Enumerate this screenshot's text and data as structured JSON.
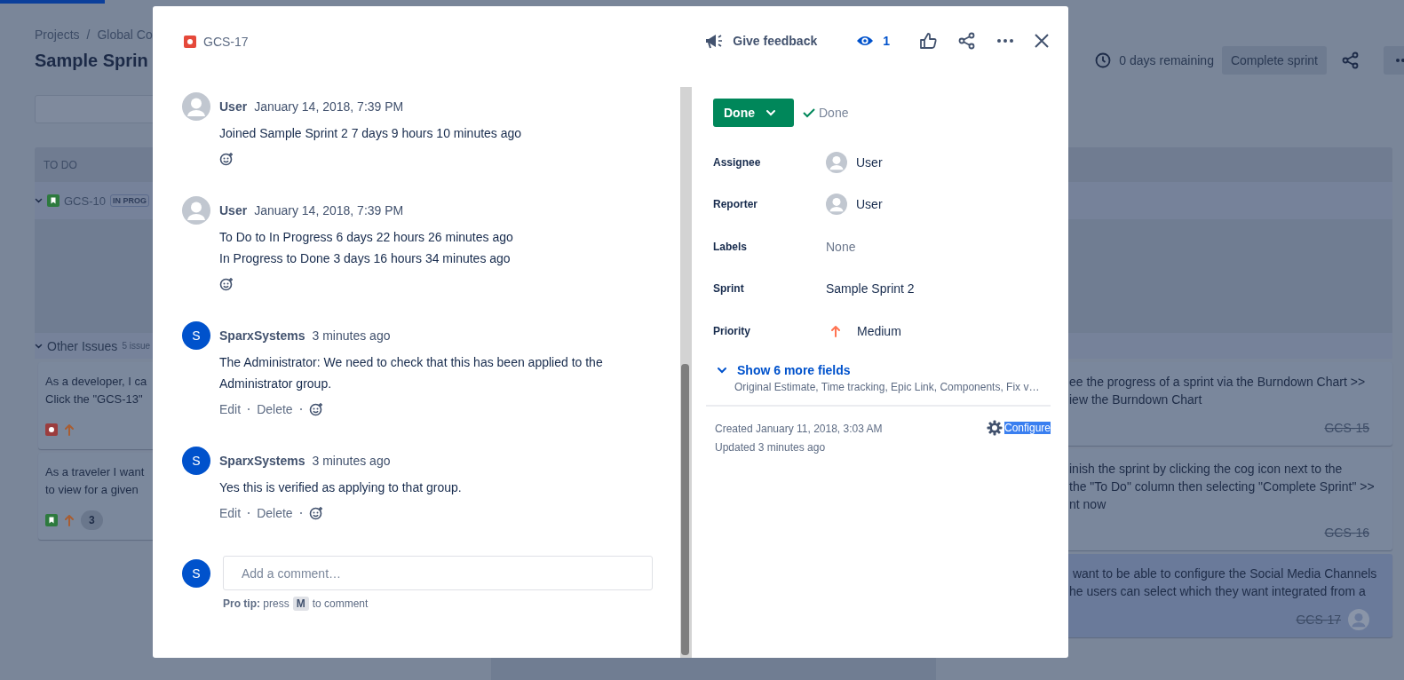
{
  "page": {
    "breadcrumbs": [
      "Projects",
      "Global Co"
    ],
    "breadcrumb_separator": "/",
    "title": "Sample Sprin",
    "remaining": "0 days remaining",
    "complete_button": "Complete sprint"
  },
  "board": {
    "column_header": "TO DO",
    "swimlanes": [
      {
        "key": "GCS-10",
        "status": "IN PROG",
        "expanded": true
      },
      {
        "title": "Other Issues",
        "count": "5 issue",
        "expanded": true
      }
    ],
    "left_cards": [
      {
        "lines": [
          "As a developer, I ca",
          "Click the \"GCS-13\""
        ],
        "kind": "bug"
      },
      {
        "lines": [
          "As a traveler I want",
          "to view for a given"
        ],
        "kind": "story",
        "badge": "3"
      }
    ],
    "right_cards": [
      {
        "lines": [
          "ee the progress of a sprint via the Burndown Chart >>",
          "iew the Burndown Chart"
        ],
        "key": "GCS-15",
        "done": true,
        "selected": false,
        "assigned": false
      },
      {
        "lines": [
          "inish the sprint by clicking the cog icon next to the",
          "the \"To Do\" column then selecting \"Complete Sprint\" >>",
          "nt now"
        ],
        "key": "GCS-16",
        "done": true,
        "selected": false,
        "assigned": false
      },
      {
        "lines": [
          " want to be able to configure the Social Media Channels",
          "he users can select which they want integrated from a"
        ],
        "key": "GCS-17",
        "done": true,
        "selected": true,
        "assigned": true
      }
    ]
  },
  "modal": {
    "issue": {
      "kind": "bug",
      "key": "GCS-17"
    },
    "feedback": "Give feedback",
    "watchers": "1",
    "activity": [
      {
        "kind": "history",
        "author": "User",
        "time": "January 14, 2018, 7:39 PM",
        "lines": [
          "Joined Sample Sprint 2 7 days 9 hours 10 minutes ago"
        ]
      },
      {
        "kind": "history",
        "author": "User",
        "time": "January 14, 2018, 7:39 PM",
        "lines": [
          "To Do to In Progress 6 days 22 hours 26 minutes ago",
          "In Progress to Done 3 days 16 hours 34 minutes ago"
        ]
      },
      {
        "kind": "comment",
        "author": "SparxSystems",
        "initial": "S",
        "time": "3 minutes ago",
        "body": "The Administrator: We need to check that this has been applied to the Administrator group.",
        "actions": [
          "Edit",
          "Delete"
        ]
      },
      {
        "kind": "comment",
        "author": "SparxSystems",
        "initial": "S",
        "time": "3 minutes ago",
        "body": "Yes this is verified as applying to that group.",
        "actions": [
          "Edit",
          "Delete"
        ]
      }
    ],
    "comment_box": {
      "initial": "S",
      "placeholder": "Add a comment…",
      "tip": "**Pro tip:** press",
      "key": "M",
      "tip_end": "to comment"
    },
    "status_button": "Done",
    "resolution": "Done",
    "fields": [
      {
        "label": "Assignee",
        "kind": "user",
        "value": "User"
      },
      {
        "label": "Reporter",
        "kind": "user",
        "value": "User"
      },
      {
        "label": "Labels",
        "kind": "empty",
        "value": "None"
      },
      {
        "label": "Sprint",
        "kind": "text",
        "value": "Sample Sprint 2"
      },
      {
        "label": "Priority",
        "kind": "priority",
        "value": "Medium"
      }
    ],
    "more_fields": {
      "label": "Show 6 more fields",
      "summary": "Original Estimate, Time tracking, Epic Link, Components, Fix v…"
    },
    "created": "Created January 11, 2018, 3:03 AM",
    "updated": "Updated 3 minutes ago",
    "configure": {
      "label": "Configure",
      "highlighted": true
    }
  }
}
